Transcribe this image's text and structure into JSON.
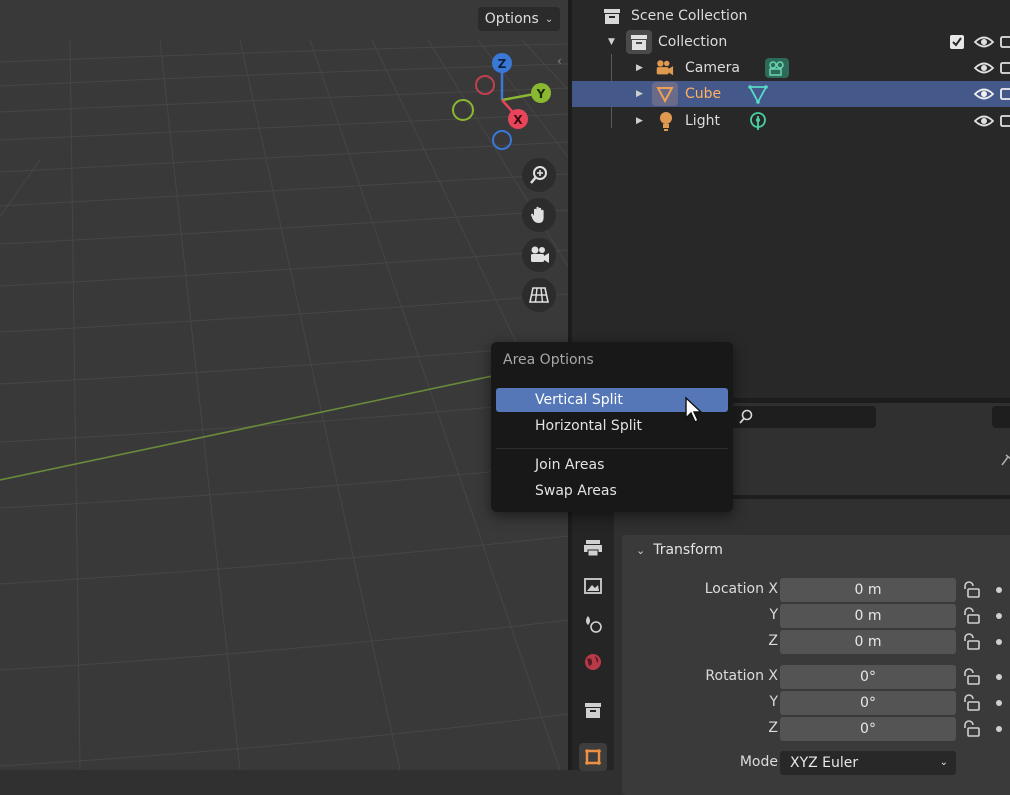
{
  "viewport": {
    "options_label": "Options",
    "gizmo": {
      "z_label": "Z",
      "y_label": "Y",
      "x_label": "X"
    },
    "nav_buttons": [
      "zoom-icon",
      "hand-pan-icon",
      "camera-view-icon",
      "ortho-grid-icon"
    ]
  },
  "outliner": {
    "scene_label": "Scene Collection",
    "collection_label": "Collection",
    "items": [
      {
        "label": "Camera",
        "icon": "camera-object-icon",
        "data_icon": "camera-data-icon",
        "selected": false
      },
      {
        "label": "Cube",
        "icon": "mesh-object-icon",
        "data_icon": "mesh-data-icon",
        "selected": true
      },
      {
        "label": "Light",
        "icon": "light-object-icon",
        "data_icon": "light-data-icon",
        "selected": false
      }
    ]
  },
  "area_menu": {
    "title": "Area Options",
    "items": [
      "Vertical Split",
      "Horizontal Split",
      "Join Areas",
      "Swap Areas"
    ]
  },
  "properties": {
    "panel_title": "Transform",
    "location": {
      "label_x": "Location X",
      "label_y": "Y",
      "label_z": "Z",
      "x": "0 m",
      "y": "0 m",
      "z": "0 m"
    },
    "rotation": {
      "label_x": "Rotation X",
      "label_y": "Y",
      "label_z": "Z",
      "x": "0°",
      "y": "0°",
      "z": "0°"
    },
    "mode": {
      "label": "Mode",
      "value": "XYZ Euler"
    }
  },
  "colors": {
    "selection_blue": "#44598a",
    "menu_highlight": "#5577b8",
    "selected_text": "#ffb060",
    "gizmo_x": "#e8455a",
    "gizmo_y": "#8ab830",
    "gizmo_z": "#3a78d8"
  }
}
